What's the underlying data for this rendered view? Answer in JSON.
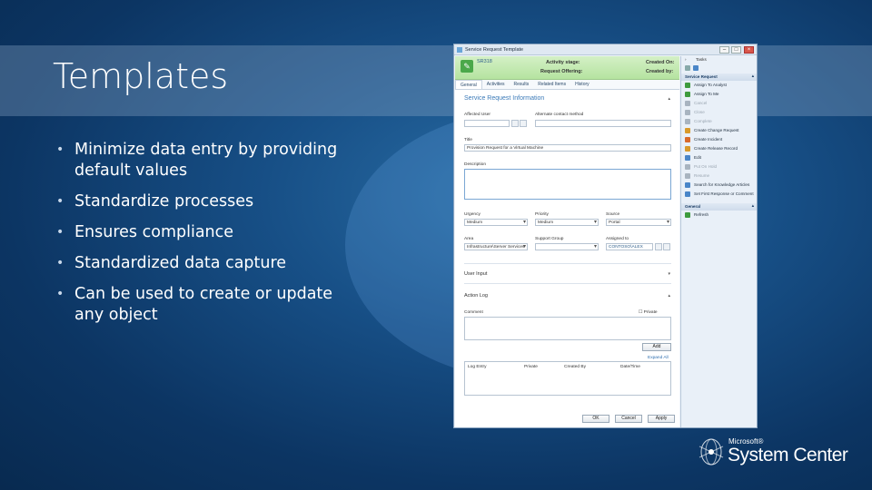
{
  "slide": {
    "title": "Templates",
    "bullets": [
      "Minimize data entry by providing default values",
      "Standardize processes",
      "Ensures compliance",
      "Standardized data capture",
      "Can be used to create or update any object"
    ]
  },
  "window": {
    "title": "Service Request Template",
    "controls": {
      "minimize": "–",
      "maximize": "□",
      "close": "×"
    },
    "header": {
      "id": "SR318",
      "activity_stage_label": "Activity stage:",
      "request_offering_label": "Request Offering:",
      "created_on_label": "Created On:",
      "created_by_label": "Created by:"
    },
    "tabs": [
      "General",
      "Activities",
      "Results",
      "Related Items",
      "History"
    ],
    "section_title": "Service Request Information",
    "fields": {
      "affected_user_label": "Affected User",
      "alternate_contact_label": "Alternate contact method",
      "title_label": "Title",
      "title_value": "Provision Request for a Virtual Machine",
      "description_label": "Description",
      "urgency_label": "Urgency",
      "urgency_value": "Medium",
      "priority_label": "Priority",
      "priority_value": "Medium",
      "source_label": "Source",
      "source_value": "Portal",
      "area_label": "Area",
      "area_value": "Infrastructure\\Server Services",
      "support_group_label": "Support Group",
      "assigned_to_label": "Assigned to",
      "assigned_to_value": "CONTOSO\\ALEX"
    },
    "user_input_label": "User Input",
    "action_log": {
      "label": "Action Log",
      "comment_label": "Comment",
      "private_label": "Private",
      "add_button": "Add",
      "expand_all": "Expand All",
      "columns": [
        "Log Entry",
        "Private",
        "Created By",
        "Date/Time"
      ]
    },
    "buttons": {
      "ok": "OK",
      "cancel": "Cancel",
      "apply": "Apply"
    }
  },
  "tasks": {
    "title": "Tasks",
    "section_service_request": "Service Request",
    "items": [
      {
        "label": "Assign To Analyst",
        "enabled": true,
        "color": "#3e9b3e"
      },
      {
        "label": "Assign To Me",
        "enabled": true,
        "color": "#3e9b3e"
      },
      {
        "label": "Cancel",
        "enabled": false,
        "color": "#a8b4c0"
      },
      {
        "label": "Close",
        "enabled": false,
        "color": "#a8b4c0"
      },
      {
        "label": "Complete",
        "enabled": false,
        "color": "#a8b4c0"
      },
      {
        "label": "Create Change Request",
        "enabled": true,
        "color": "#d99a2b"
      },
      {
        "label": "Create Incident",
        "enabled": true,
        "color": "#d96a2b"
      },
      {
        "label": "Create Release Record",
        "enabled": true,
        "color": "#d99a2b"
      },
      {
        "label": "Edit",
        "enabled": true,
        "color": "#4a86c8"
      },
      {
        "label": "Put On Hold",
        "enabled": false,
        "color": "#a8b4c0"
      },
      {
        "label": "Resume",
        "enabled": false,
        "color": "#a8b4c0"
      },
      {
        "label": "Search for Knowledge Articles",
        "enabled": true,
        "color": "#4a86c8"
      },
      {
        "label": "Set First Response or Comment",
        "enabled": true,
        "color": "#4a86c8"
      }
    ],
    "section_general": "General",
    "general_items": [
      {
        "label": "Refresh",
        "color": "#3e9b3e"
      }
    ]
  },
  "brand": {
    "small": "Microsoft®",
    "big": "System Center"
  }
}
